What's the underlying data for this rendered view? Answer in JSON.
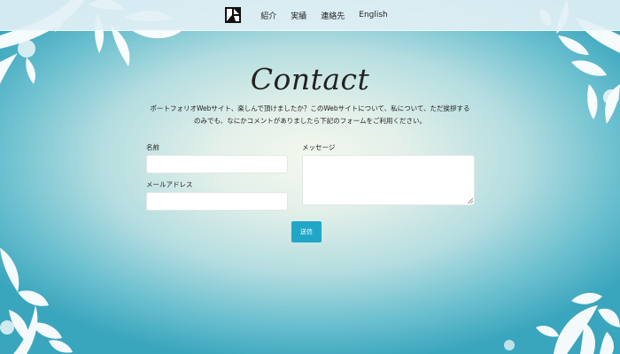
{
  "nav": {
    "logo_icon": "monogram-logo-icon",
    "links": [
      "紹介",
      "実績",
      "連絡先",
      "English"
    ]
  },
  "main": {
    "title": "Contact",
    "intro_line1": "ポートフォリオWebサイト、楽しんで頂けましたか？このWebサイトについて、私について、ただ挨拶する",
    "intro_line2": "のみでも、なにかコメントがありましたら下記のフォームをご利用ください。"
  },
  "form": {
    "name_label": "名前",
    "name_value": "",
    "email_label": "メールアドレス",
    "email_value": "",
    "message_label": "メッセージ",
    "message_value": "",
    "submit_label": "送信"
  },
  "colors": {
    "accent": "#22a6c8",
    "navbar": "#e2f0f5",
    "background_center": "#f4f8ee",
    "background_edge": "#3aa6bd"
  }
}
